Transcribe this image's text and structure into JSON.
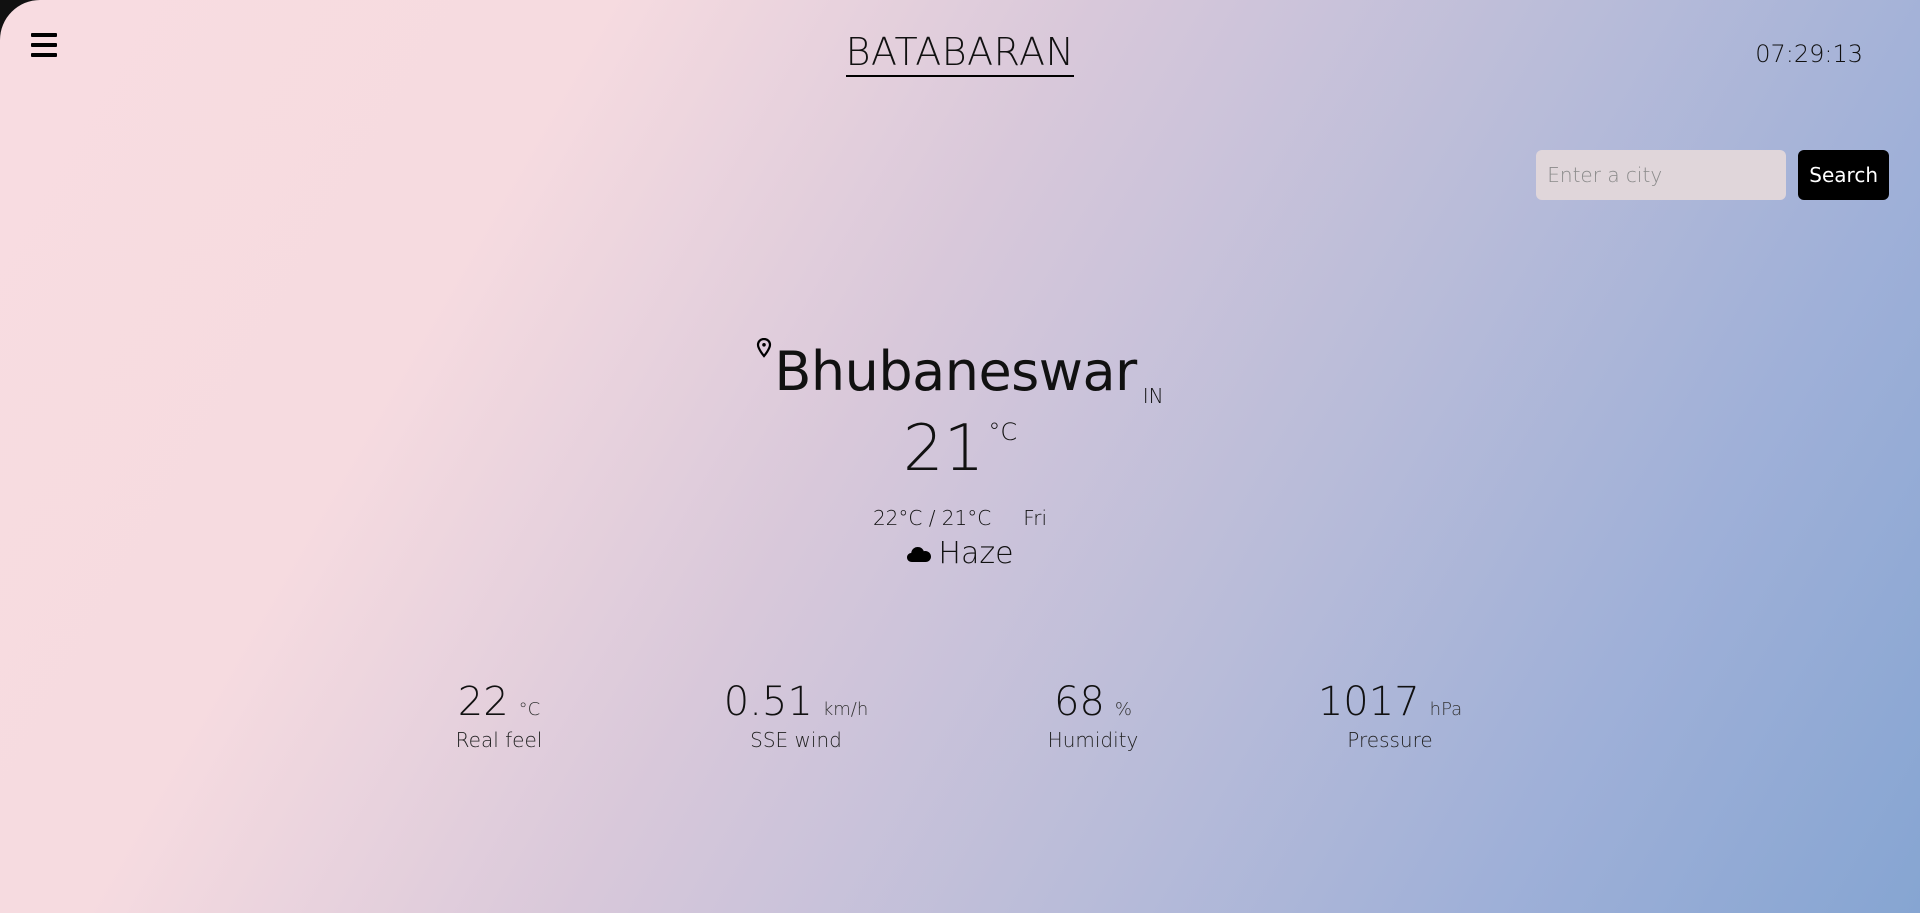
{
  "header": {
    "brand": "BATABARAN",
    "clock": "07:29:13"
  },
  "search": {
    "placeholder": "Enter a city",
    "value": "",
    "button_label": "Search"
  },
  "weather": {
    "city": "Bhubaneswar",
    "country": "IN",
    "temperature": "21",
    "temperature_unit": "°C",
    "minmax": "22°C / 21°C",
    "day": "Fri",
    "condition": "Haze",
    "condition_icon": "cloud-icon"
  },
  "stats": [
    {
      "value": "22",
      "unit": "°C",
      "label": "Real feel"
    },
    {
      "value": "0.51",
      "unit": "km/h",
      "label": "SSE wind"
    },
    {
      "value": "68",
      "unit": "%",
      "label": "Humidity"
    },
    {
      "value": "1017",
      "unit": "hPa",
      "label": "Pressure"
    }
  ],
  "colors": {
    "gradient_start": "#f8dce1",
    "gradient_end": "#86a5d2",
    "button_bg": "#000000",
    "input_bg": "#e0d6da"
  }
}
